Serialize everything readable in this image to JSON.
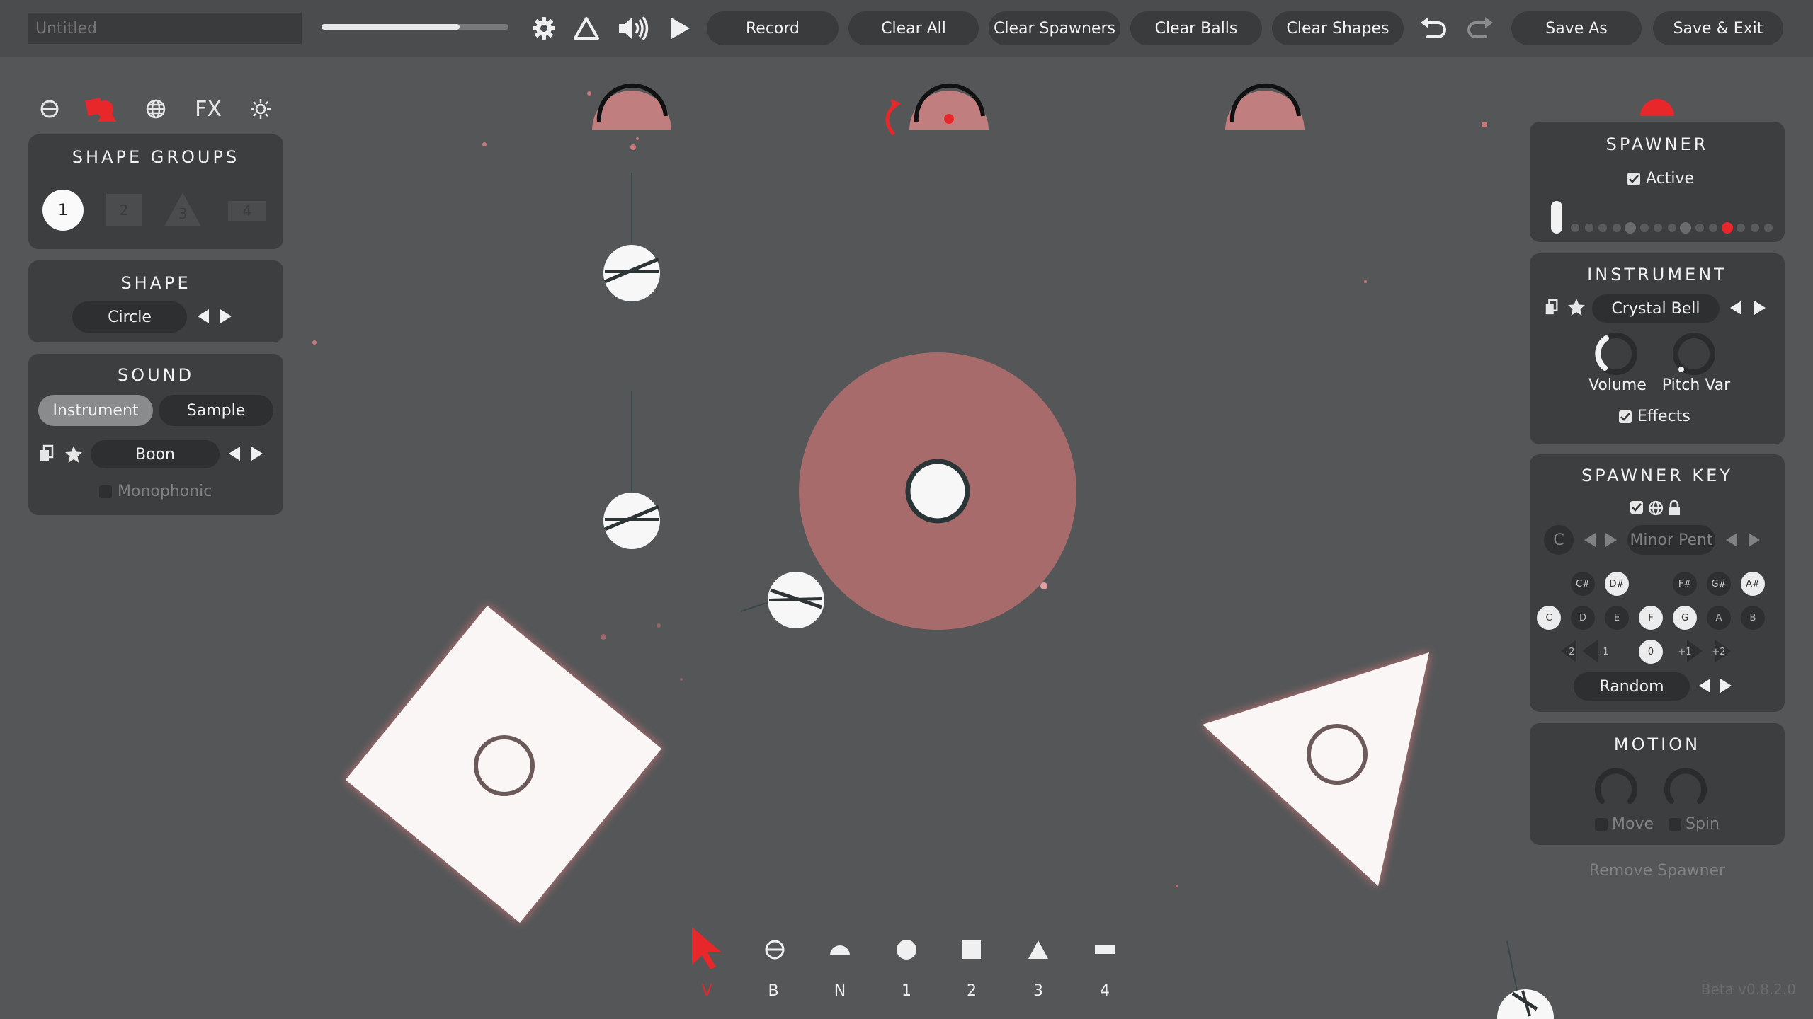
{
  "header": {
    "title_placeholder": "Untitled",
    "tempo_level": 0.74,
    "icons": [
      "gear-icon",
      "triangle-icon",
      "speaker-icon",
      "play-icon"
    ],
    "buttons": {
      "record": "Record",
      "clear_all": "Clear All",
      "clear_spawners": "Clear Spawners",
      "clear_balls": "Clear Balls",
      "clear_shapes": "Clear Shapes",
      "save_as": "Save As",
      "save_exit": "Save & Exit"
    }
  },
  "left_tabs": [
    "no-entry-icon",
    "shapes-icon",
    "globe-icon",
    "FX",
    "sun-icon"
  ],
  "shape_groups": {
    "title": "SHAPE GROUPS",
    "items": [
      "1",
      "2",
      "3",
      "4"
    ],
    "active": "1"
  },
  "shape": {
    "title": "SHAPE",
    "value": "Circle"
  },
  "sound": {
    "title": "SOUND",
    "tabs": [
      "Instrument",
      "Sample"
    ],
    "active_tab": "Instrument",
    "preset": "Boon",
    "monophonic_label": "Monophonic",
    "monophonic_checked": false
  },
  "spawner": {
    "title": "SPAWNER",
    "active_label": "Active",
    "active_checked": true,
    "dots_count": 15,
    "active_dot": 11
  },
  "instrument": {
    "title": "INSTRUMENT",
    "preset": "Crystal Bell",
    "volume_label": "Volume",
    "pitchvar_label": "Pitch Var",
    "effects_label": "Effects",
    "effects_checked": true
  },
  "spawner_key": {
    "title": "SPAWNER KEY",
    "root": "C",
    "scale": "Minor Pent",
    "sharps": [
      "C#",
      "D#",
      "F#",
      "G#",
      "A#"
    ],
    "sharps_on": [
      "D#",
      "A#"
    ],
    "naturals": [
      "C",
      "D",
      "E",
      "F",
      "G",
      "A",
      "B"
    ],
    "naturals_on": [
      "C",
      "F",
      "G"
    ],
    "octaves": [
      "-2",
      "-1",
      "0",
      "+1",
      "+2"
    ],
    "octave_on": "0",
    "mode": "Random"
  },
  "motion": {
    "title": "MOTION",
    "move_label": "Move",
    "spin_label": "Spin"
  },
  "remove_spawner": "Remove Spawner",
  "version": "Beta v0.8.2.0",
  "toolbar": {
    "keys": [
      "V",
      "B",
      "N",
      "1",
      "2",
      "3",
      "4"
    ],
    "icons": [
      "cursor-icon",
      "no-entry-icon",
      "half-circle-icon",
      "circle-icon",
      "square-icon",
      "triangle-icon",
      "bar-icon"
    ],
    "active": "V"
  },
  "colors": {
    "accent": "#e8272a",
    "shape_pink": "#b86f6f",
    "panel": "#3d3e40",
    "background": "#545658"
  }
}
